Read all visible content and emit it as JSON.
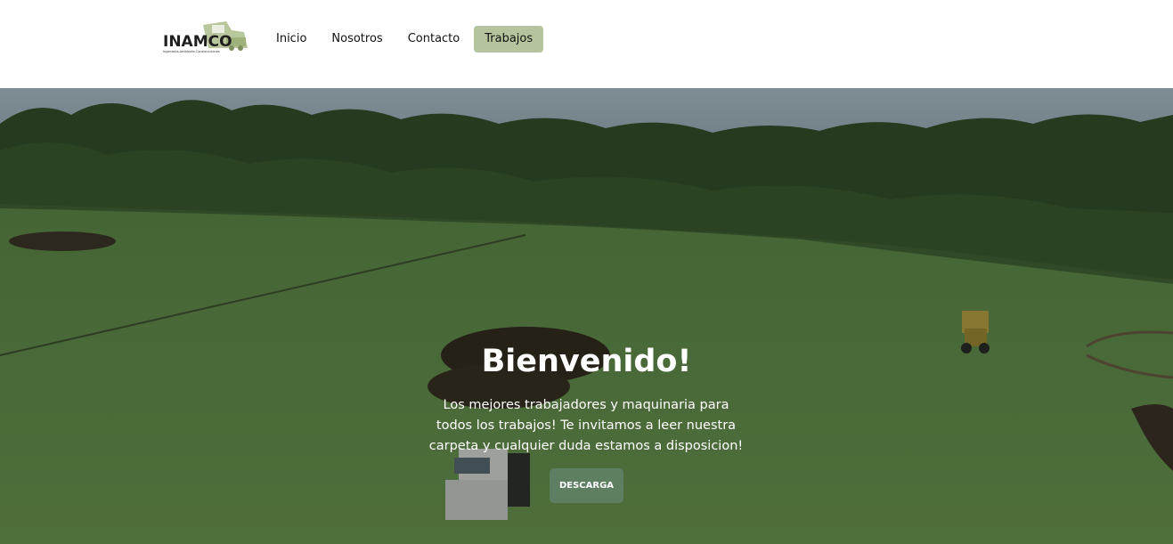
{
  "brand": {
    "name": "INAMCO",
    "tagline": "Ingeniería-Ambiente-Construcciones",
    "accent_color": "#b5c49c"
  },
  "nav": {
    "items": [
      {
        "label": "Inicio",
        "active": false
      },
      {
        "label": "Nosotros",
        "active": false
      },
      {
        "label": "Contacto",
        "active": false
      },
      {
        "label": "Trabajos",
        "active": true
      }
    ]
  },
  "hero": {
    "title": "Bienvenido!",
    "text": "Los mejores trabajadores y maquinaria para todos los trabajos! Te invitamos a leer nuestra carpeta y cualquier duda estamos a disposicion!",
    "button_label": "DESCARGA",
    "button_color": "#5f7f62",
    "background": "aerial photo of green field with trees, dirt mounds, truck and tractor"
  }
}
